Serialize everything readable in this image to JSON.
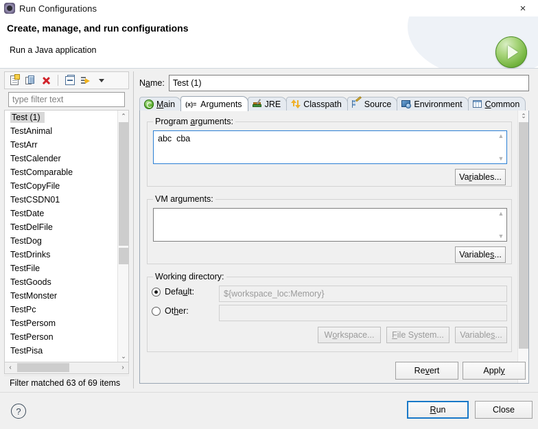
{
  "window": {
    "title": "Run Configurations",
    "title_icon": "run-configurations-icon",
    "close_icon": "×"
  },
  "header": {
    "title": "Create, manage, and run configurations",
    "subtitle": "Run a Java application",
    "badge_icon": "green-run-play-icon"
  },
  "left_panel": {
    "toolbar": [
      {
        "name": "new-configuration-button",
        "icon": "new-document-icon"
      },
      {
        "name": "duplicate-configuration-button",
        "icon": "duplicate-icon"
      },
      {
        "name": "delete-configuration-button",
        "icon": "red-x-delete-icon"
      },
      {
        "name": "collapse-all-button",
        "icon": "collapse-all-icon"
      },
      {
        "name": "filter-configurations-button",
        "icon": "filter-arrow-icon"
      },
      {
        "name": "view-menu-button",
        "icon": "chevron-down-icon"
      }
    ],
    "filter": {
      "value": "",
      "placeholder": "type filter text"
    },
    "items": [
      "Test (1)",
      "TestAnimal",
      "TestArr",
      "TestCalender",
      "TestComparable",
      "TestCopyFile",
      "TestCSDN01",
      "TestDate",
      "TestDelFile",
      "TestDog",
      "TestDrinks",
      "TestFile",
      "TestGoods",
      "TestMonster",
      "TestPc",
      "TestPersom",
      "TestPerson",
      "TestPisa"
    ],
    "selected_item": "Test (1)",
    "status": "Filter matched 63 of 69 items",
    "scroll_up_icon": "⌃",
    "scroll_down_icon": "⌄",
    "scroll_left_icon": "‹",
    "scroll_right_icon": "›"
  },
  "right_panel": {
    "name": {
      "label_pre": "N",
      "label_accel": "a",
      "label_post": "me:",
      "value": "Test (1)"
    },
    "tabs": [
      {
        "label": "Main",
        "icon": "main-java-icon",
        "active": false
      },
      {
        "label": "Arguments",
        "icon": "arguments-x-icon",
        "active": true
      },
      {
        "label": "JRE",
        "icon": "jre-books-icon",
        "active": false
      },
      {
        "label": "Classpath",
        "icon": "classpath-arrows-icon",
        "active": false
      },
      {
        "label": "Source",
        "icon": "source-tree-pencil-icon",
        "active": false
      },
      {
        "label": "Environment",
        "icon": "environment-monitor-icon",
        "active": false
      },
      {
        "label": "Common",
        "icon": "common-table-icon",
        "active": false
      }
    ],
    "program_arguments": {
      "label_pre": "Program ",
      "label_accel": "a",
      "label_post": "rguments:",
      "value": "abc  cba",
      "variables_button": {
        "pre": "Va",
        "accel": "r",
        "post": "iables..."
      }
    },
    "vm_arguments": {
      "label_pre": "VM ar",
      "label_accel": "g",
      "label_post": "uments:",
      "value": "",
      "variables_button": {
        "pre": "Variable",
        "accel": "s",
        "post": "..."
      }
    },
    "working_directory": {
      "label": "Working directory:",
      "default_radio": {
        "pre": "Defa",
        "accel": "u",
        "post": "lt:",
        "selected": true
      },
      "default_value": "${workspace_loc:Memory}",
      "other_radio": {
        "pre": "Ot",
        "accel": "h",
        "post": "er:",
        "selected": false
      },
      "other_value": "",
      "buttons": [
        {
          "name": "workspace-button",
          "pre": "W",
          "accel": "o",
          "post": "rkspace...",
          "disabled": true
        },
        {
          "name": "file-system-button",
          "pre": "",
          "accel": "F",
          "post": "ile System...",
          "disabled": true
        },
        {
          "name": "variables-button",
          "pre": "Variable",
          "accel": "s",
          "post": "...",
          "disabled": true
        }
      ]
    },
    "revert_button": {
      "pre": "Re",
      "accel": "v",
      "post": "ert"
    },
    "apply_button": {
      "pre": "Appl",
      "accel": "y",
      "post": ""
    }
  },
  "footer": {
    "help_icon": "?",
    "run_button": {
      "pre": "",
      "accel": "R",
      "post": "un"
    },
    "close_button": {
      "pre": "Close",
      "accel": "",
      "post": ""
    }
  },
  "colors": {
    "accent_blue": "#1878c8",
    "focus_border": "#2a7fd4",
    "run_green": "#74b43f",
    "delete_red": "#d1232a",
    "dialog_bg": "#f0f0f0",
    "selection_gray": "#d8d8d8"
  }
}
